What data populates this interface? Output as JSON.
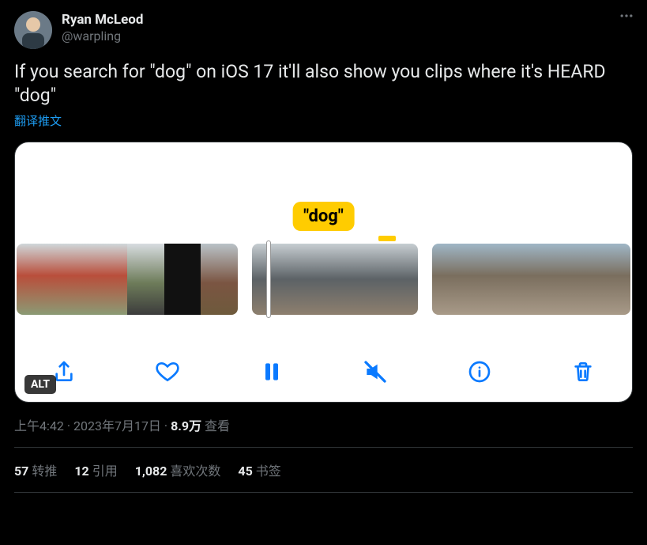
{
  "author": {
    "display_name": "Ryan McLeod",
    "handle": "@warpling"
  },
  "tweet_text": "If you search for \"dog\" on iOS 17 it'll also show you clips where it's HEARD \"dog\"",
  "translate_label": "翻译推文",
  "media": {
    "alt_badge": "ALT",
    "tooltip_label": "\"dog\"",
    "toolbar_icons": [
      "share",
      "heart",
      "pause",
      "mute",
      "info",
      "trash"
    ]
  },
  "meta": {
    "time": "上午4:42",
    "date": "2023年7月17日",
    "views_count": "8.9万",
    "views_label": "查看",
    "sep": " · "
  },
  "stats": {
    "reposts_count": "57",
    "reposts_label": "转推",
    "quotes_count": "12",
    "quotes_label": "引用",
    "likes_count": "1,082",
    "likes_label": "喜欢次数",
    "bookmarks_count": "45",
    "bookmarks_label": "书签"
  }
}
